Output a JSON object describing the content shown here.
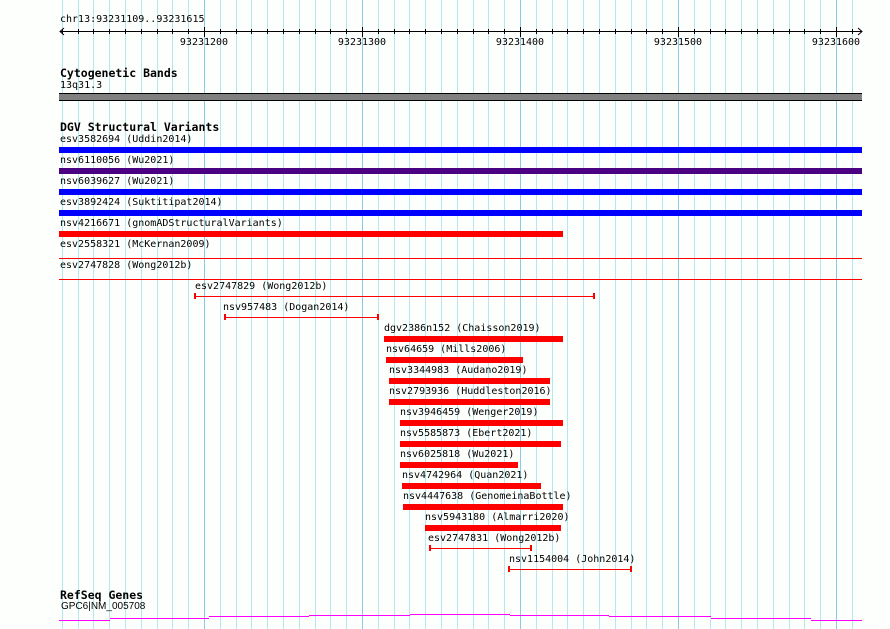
{
  "ruler": {
    "location": "chr13:93231109..93231615",
    "start": 93231109,
    "end": 93231615,
    "ticks": [
      "93231200",
      "93231300",
      "93231400",
      "93231500",
      "93231600"
    ]
  },
  "cytoband_track": {
    "title": "Cytogenetic Bands",
    "band": "13q31.3",
    "color": "#808080"
  },
  "dgv_track": {
    "title": "DGV Structural Variants",
    "full_rows": [
      {
        "label": "esv3582694 (Uddin2014)",
        "color": "#0000ff",
        "style": "bar"
      },
      {
        "label": "nsv6110056 (Wu2021)",
        "color": "#4b0082",
        "style": "bar"
      },
      {
        "label": "nsv6039627 (Wu2021)",
        "color": "#0000ff",
        "style": "bar"
      },
      {
        "label": "esv3892424 (Suktitipat2014)",
        "color": "#0000ff",
        "style": "bar"
      },
      {
        "label": "nsv4216671 (gnomADStructuralVariants)",
        "color": "#ff0000",
        "style": "bar",
        "end": 93231427
      },
      {
        "label": "esv2558321 (McKernan2009)",
        "color": "#ff0000",
        "style": "line"
      },
      {
        "label": "esv2747828 (Wong2012b)",
        "color": "#ff0000",
        "style": "line"
      }
    ],
    "features": [
      {
        "label": "esv2747829 (Wong2012b)",
        "start": 93231194,
        "end": 93231447,
        "style": "line"
      },
      {
        "label": "nsv957483 (Dogan2014)",
        "start": 93231213,
        "end": 93231310,
        "style": "line",
        "label_pos": 93231212
      },
      {
        "label": "dgv2386n152 (Chaisson2019)",
        "start": 93231314,
        "end": 93231427,
        "style": "bar"
      },
      {
        "label": "nsv64659 (Mills2006)",
        "start": 93231315,
        "end": 93231402,
        "style": "bar"
      },
      {
        "label": "nsv3344983 (Audano2019)",
        "start": 93231317,
        "end": 93231419,
        "style": "bar"
      },
      {
        "label": "nsv2793936 (Huddleston2016)",
        "start": 93231317,
        "end": 93231419,
        "style": "bar"
      },
      {
        "label": "nsv3946459 (Wenger2019)",
        "start": 93231324,
        "end": 93231427,
        "style": "bar"
      },
      {
        "label": "nsv5585873 (Ebert2021)",
        "start": 93231324,
        "end": 93231426,
        "style": "bar"
      },
      {
        "label": "nsv6025818 (Wu2021)",
        "start": 93231324,
        "end": 93231399,
        "style": "bar"
      },
      {
        "label": "nsv4742964 (Quan2021)",
        "start": 93231325,
        "end": 93231413,
        "style": "bar"
      },
      {
        "label": "nsv4447638 (GenomeinaBottle)",
        "start": 93231326,
        "end": 93231427,
        "style": "bar"
      },
      {
        "label": "nsv5943180 (Almarri2020)",
        "start": 93231340,
        "end": 93231426,
        "style": "bar"
      },
      {
        "label": "esv2747831 (Wong2012b)",
        "start": 93231343,
        "end": 93231407,
        "style": "line",
        "label_pos": 93231342
      },
      {
        "label": "nsv1154004 (John2014)",
        "start": 93231393,
        "end": 93231470,
        "style": "line"
      }
    ],
    "feature_color": "#ff0000"
  },
  "refseq_track": {
    "title": "RefSeq Genes",
    "gene": "GPC6|NM_005708",
    "color": "#ff00ff"
  }
}
